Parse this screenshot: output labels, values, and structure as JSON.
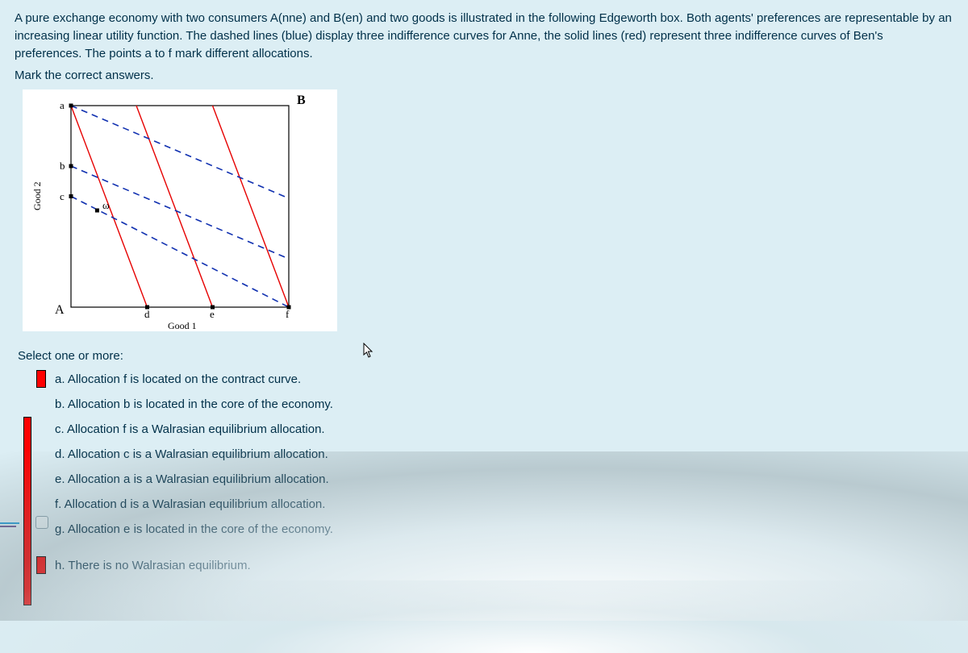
{
  "question": {
    "paragraph1": "A pure exchange economy with two consumers A(nne) and B(en) and two goods is illustrated in the following Edgeworth box. Both agents' preferences are representable by an increasing linear utility function. The dashed lines (blue) display three indifference curves for Anne, the solid lines (red) represent three indifference curves of Ben's preferences. The points a to f mark different allocations.",
    "instruction": "Mark the correct answers."
  },
  "figure": {
    "corner_B": "B",
    "corner_A": "A",
    "xlabel": "Good 1",
    "ylabel": "Good 2",
    "points": {
      "a": "a",
      "b": "b",
      "c": "c",
      "d": "d",
      "e": "e",
      "f": "f",
      "omega": "ω"
    }
  },
  "prompt": "Select one or more:",
  "options": {
    "a": "a. Allocation f is located on the contract curve.",
    "b": "b. Allocation b is located in the core of the economy.",
    "c": "c. Allocation f is a Walrasian equilibrium allocation.",
    "d": "d. Allocation c is a Walrasian equilibrium allocation.",
    "e": "e. Allocation a is a Walrasian equilibrium allocation.",
    "f": "f. Allocation d is a Walrasian equilibrium allocation.",
    "g": "g. Allocation e is located in the core of the economy.",
    "h": "h. There is no Walrasian equilibrium."
  },
  "chart_data": {
    "type": "diagram",
    "description": "Edgeworth box with origin A at bottom-left and origin B at top-right.",
    "xlabel": "Good 1",
    "ylabel": "Good 2",
    "box": {
      "x": [
        0,
        1
      ],
      "y": [
        0,
        1
      ]
    },
    "allocations": [
      {
        "name": "a",
        "x": 0.0,
        "y": 1.0
      },
      {
        "name": "b",
        "x": 0.0,
        "y": 0.7
      },
      {
        "name": "c",
        "x": 0.0,
        "y": 0.55
      },
      {
        "name": "ω",
        "x": 0.12,
        "y": 0.48
      },
      {
        "name": "d",
        "x": 0.35,
        "y": 0.0
      },
      {
        "name": "e",
        "x": 0.65,
        "y": 0.0
      },
      {
        "name": "f",
        "x": 1.0,
        "y": 0.0
      }
    ],
    "series": [
      {
        "name": "Anne IC 1",
        "agent": "Anne",
        "style": "dashed-blue",
        "endpoints": [
          [
            0.0,
            1.0
          ],
          [
            1.0,
            0.54
          ]
        ]
      },
      {
        "name": "Anne IC 2",
        "agent": "Anne",
        "style": "dashed-blue",
        "endpoints": [
          [
            0.0,
            0.7
          ],
          [
            1.0,
            0.24
          ]
        ]
      },
      {
        "name": "Anne IC 3",
        "agent": "Anne",
        "style": "dashed-blue",
        "endpoints": [
          [
            0.0,
            0.55
          ],
          [
            1.0,
            0.0
          ]
        ]
      },
      {
        "name": "Ben IC 1",
        "agent": "Ben",
        "style": "solid-red",
        "endpoints": [
          [
            0.0,
            1.0
          ],
          [
            0.35,
            0.0
          ]
        ]
      },
      {
        "name": "Ben IC 2",
        "agent": "Ben",
        "style": "solid-red",
        "endpoints": [
          [
            0.3,
            1.0
          ],
          [
            0.65,
            0.0
          ]
        ]
      },
      {
        "name": "Ben IC 3",
        "agent": "Ben",
        "style": "solid-red",
        "endpoints": [
          [
            0.65,
            1.0
          ],
          [
            1.0,
            0.0
          ]
        ]
      }
    ]
  }
}
